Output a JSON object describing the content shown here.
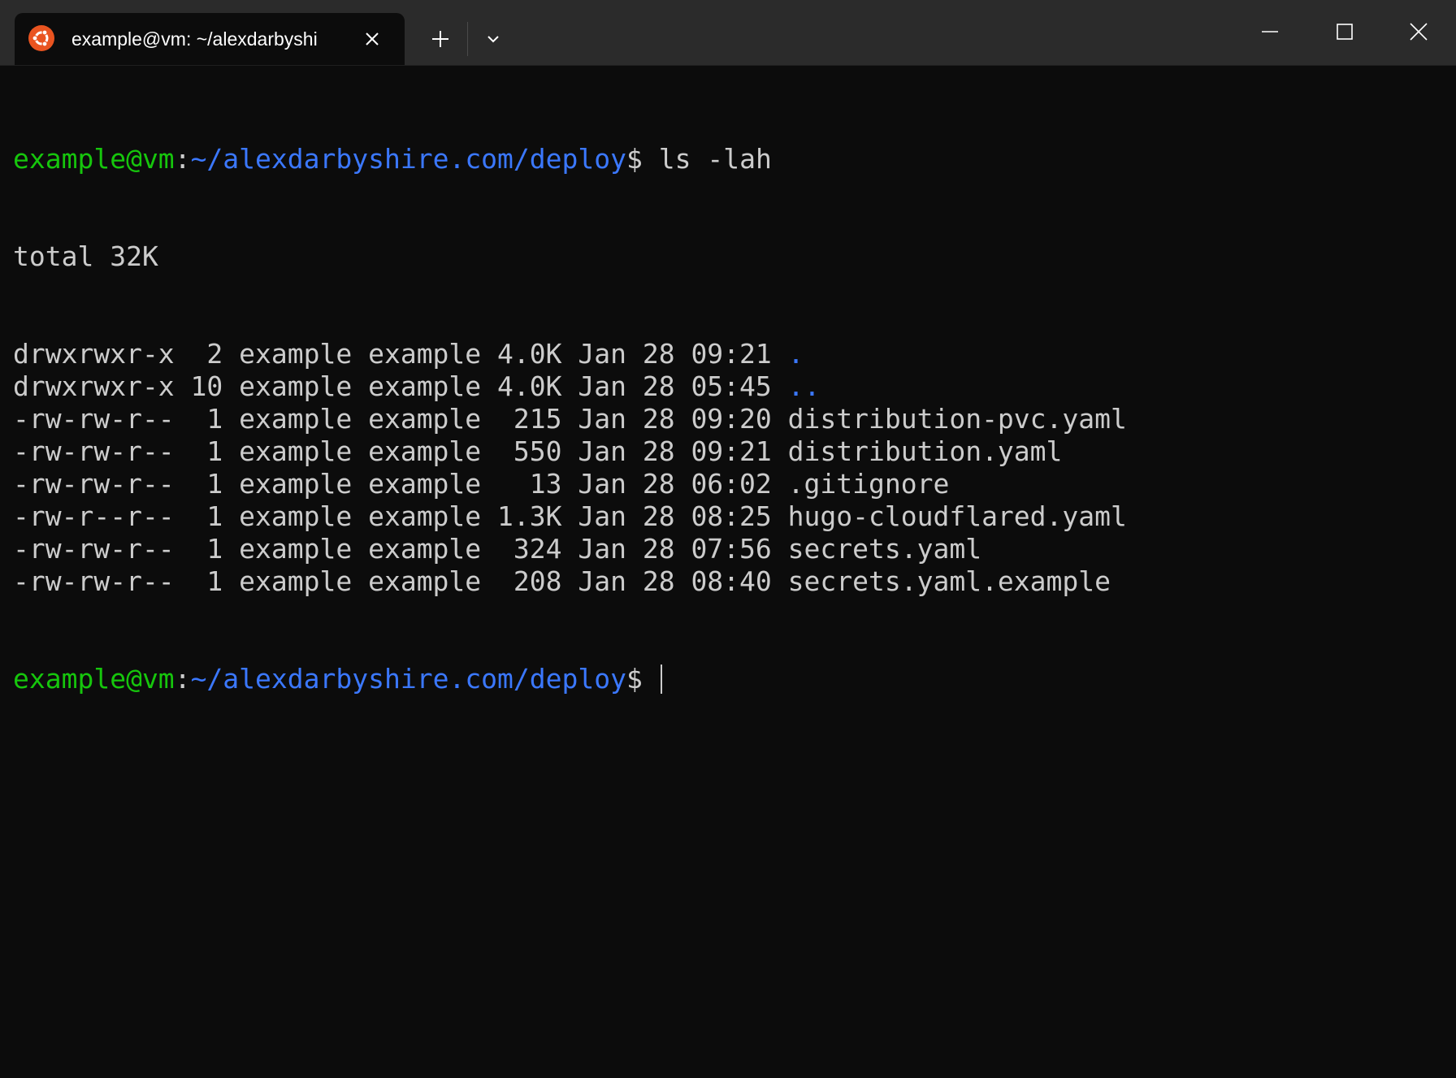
{
  "window": {
    "tab_title": "example@vm: ~/alexdarbyshi",
    "tab_icon": "ubuntu-icon",
    "new_tab_icon": "plus-icon",
    "dropdown_icon": "chevron-down-icon",
    "controls": [
      "minimize-icon",
      "maximize-icon",
      "close-icon"
    ]
  },
  "colors": {
    "background": "#0c0c0c",
    "titlebar": "#2b2b2b",
    "text": "#cccccc",
    "prompt_user": "#16c60c",
    "prompt_path": "#3b78ff",
    "ubuntu_orange": "#e95420"
  },
  "terminal": {
    "prompt": {
      "user_host": "example@vm",
      "colon": ":",
      "path": "~/alexdarbyshire.com/deploy",
      "dollar": "$"
    },
    "command": " ls -lah",
    "total": "total 32K",
    "entries": [
      {
        "meta": "drwxrwxr-x  2 example example 4.0K Jan 28 09:21 ",
        "name": ".",
        "is_dir": true
      },
      {
        "meta": "drwxrwxr-x 10 example example 4.0K Jan 28 05:45 ",
        "name": "..",
        "is_dir": true
      },
      {
        "meta": "-rw-rw-r--  1 example example  215 Jan 28 09:20 ",
        "name": "distribution-pvc.yaml",
        "is_dir": false
      },
      {
        "meta": "-rw-rw-r--  1 example example  550 Jan 28 09:21 ",
        "name": "distribution.yaml",
        "is_dir": false
      },
      {
        "meta": "-rw-rw-r--  1 example example   13 Jan 28 06:02 ",
        "name": ".gitignore",
        "is_dir": false
      },
      {
        "meta": "-rw-r--r--  1 example example 1.3K Jan 28 08:25 ",
        "name": "hugo-cloudflared.yaml",
        "is_dir": false
      },
      {
        "meta": "-rw-rw-r--  1 example example  324 Jan 28 07:56 ",
        "name": "secrets.yaml",
        "is_dir": false
      },
      {
        "meta": "-rw-rw-r--  1 example example  208 Jan 28 08:40 ",
        "name": "secrets.yaml.example",
        "is_dir": false
      }
    ]
  }
}
